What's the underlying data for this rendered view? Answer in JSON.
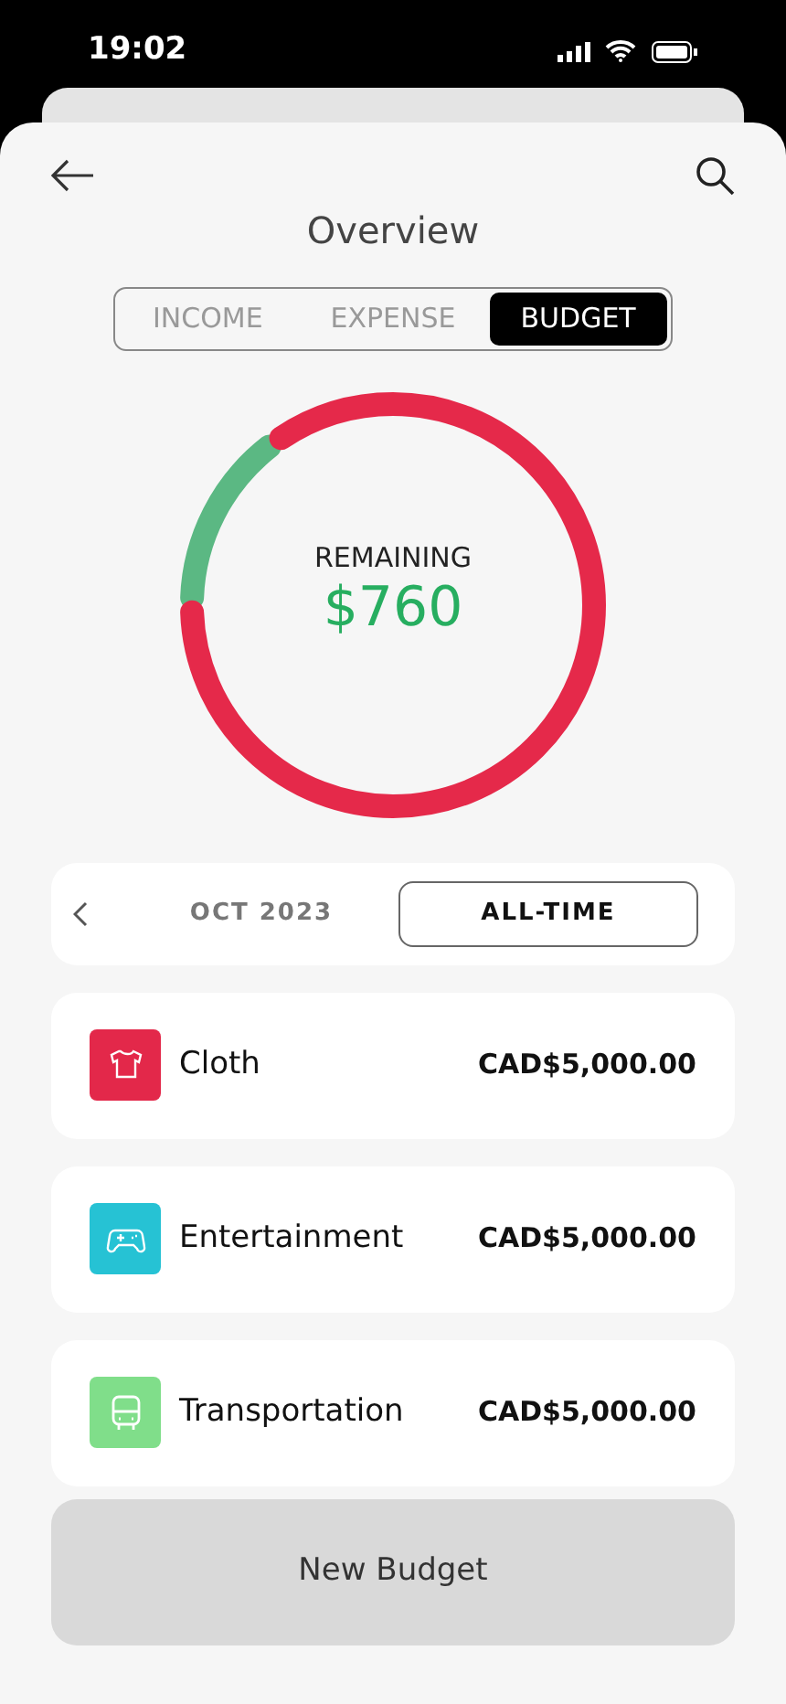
{
  "status_bar": {
    "time": "19:02"
  },
  "header": {
    "title": "Overview"
  },
  "tabs": [
    {
      "label": "INCOME",
      "selected": false
    },
    {
      "label": "EXPENSE",
      "selected": false
    },
    {
      "label": "BUDGET",
      "selected": true
    }
  ],
  "ring": {
    "label": "REMAINING",
    "amount": "$760"
  },
  "period": {
    "options": [
      {
        "label": "OCT 2023",
        "selected": false
      },
      {
        "label": "ALL-TIME",
        "selected": true
      }
    ]
  },
  "budgets": [
    {
      "kind": "shirt",
      "name": "Cloth",
      "amount": "CAD$5,000.00",
      "color": "#e3284a"
    },
    {
      "kind": "gamepad",
      "name": "Entertainment",
      "amount": "CAD$5,000.00",
      "color": "#26c2d4"
    },
    {
      "kind": "bus",
      "name": "Transportation",
      "amount": "CAD$5,000.00",
      "color": "#80de8a"
    }
  ],
  "new_button": "New Budget"
}
